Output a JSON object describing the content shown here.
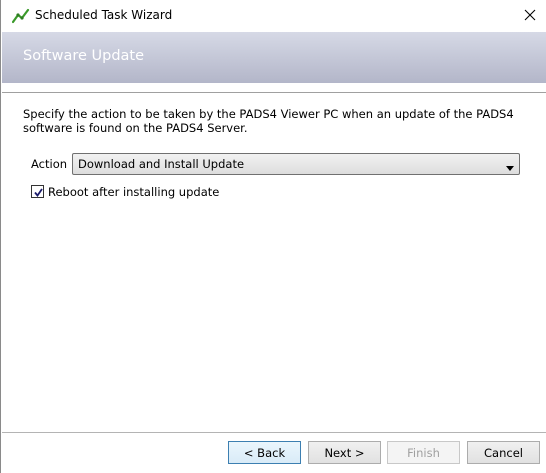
{
  "window": {
    "title": "Scheduled Task Wizard"
  },
  "banner": {
    "title": "Software Update"
  },
  "description": "Specify the action to be taken by the PADS4 Viewer PC when an update of the PADS4 software is found on the PADS4 Server.",
  "action": {
    "label": "Action",
    "selected": "Download and Install Update"
  },
  "reboot": {
    "label": "Reboot after installing update",
    "checked": true
  },
  "buttons": {
    "back": "< Back",
    "next": "Next >",
    "finish": "Finish",
    "cancel": "Cancel"
  },
  "colors": {
    "banner_top": "#d6d9e6",
    "banner_bottom": "#b3b6c9",
    "icon_green": "#3a9a2a"
  }
}
